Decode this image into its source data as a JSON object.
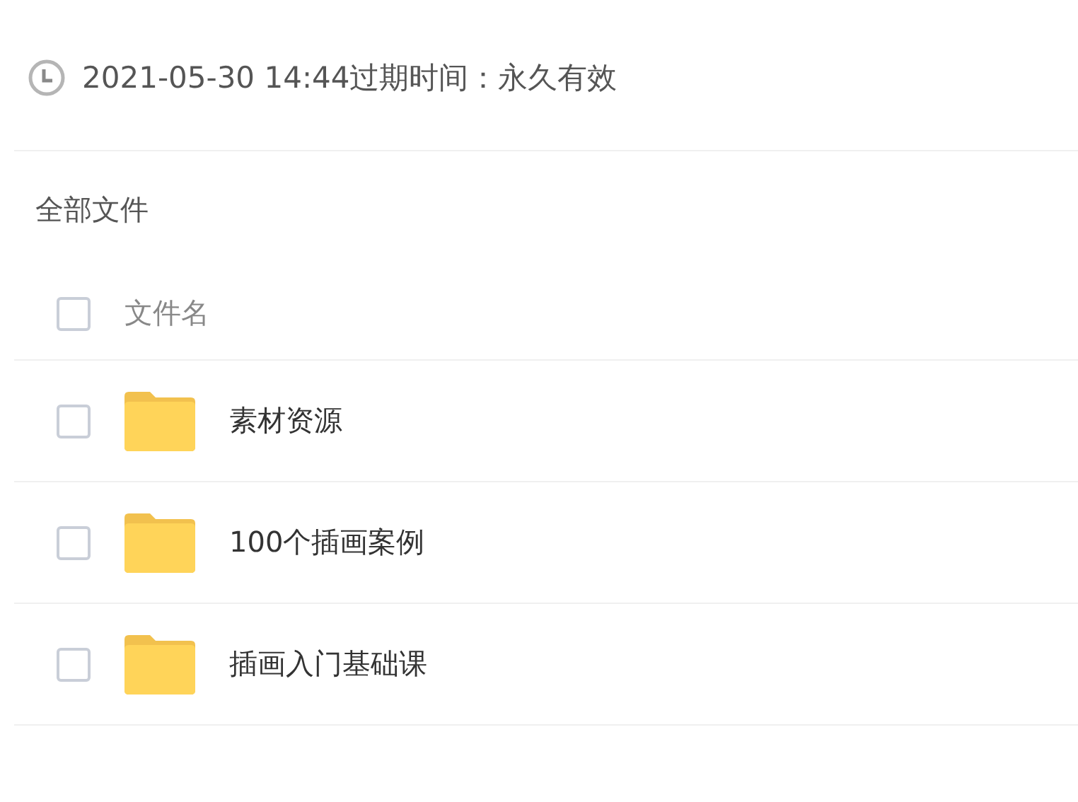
{
  "info": {
    "text": "2021-05-30 14:44过期时间：永久有效"
  },
  "breadcrumb": "全部文件",
  "header": {
    "checked": false,
    "label": "文件名"
  },
  "files": [
    {
      "kind": "folder",
      "name": "素材资源",
      "checked": false
    },
    {
      "kind": "folder",
      "name": "100个插画案例",
      "checked": false
    },
    {
      "kind": "folder",
      "name": "插画入门基础课",
      "checked": false
    }
  ]
}
